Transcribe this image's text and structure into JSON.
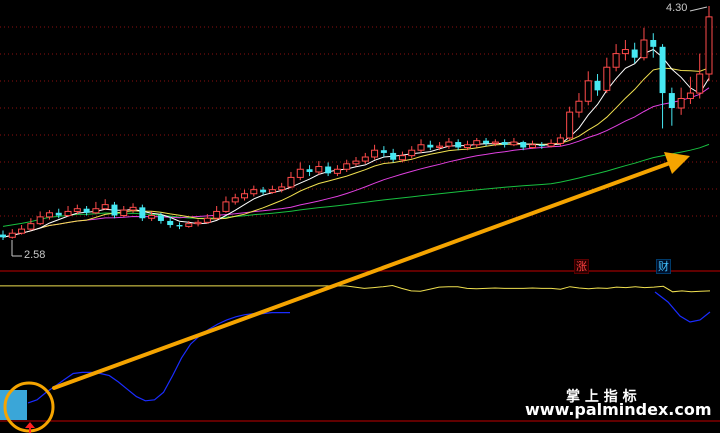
{
  "price_panel": {
    "high_label": "4.30",
    "low_label": "2.58",
    "event_badges": [
      "涨",
      "财"
    ],
    "candles": [
      [
        2.62,
        2.6,
        2.65,
        2.58
      ],
      [
        2.6,
        2.63,
        2.66,
        2.59
      ],
      [
        2.63,
        2.66,
        2.69,
        2.62
      ],
      [
        2.66,
        2.7,
        2.74,
        2.65
      ],
      [
        2.7,
        2.75,
        2.79,
        2.69
      ],
      [
        2.75,
        2.78,
        2.8,
        2.73
      ],
      [
        2.78,
        2.76,
        2.81,
        2.74
      ],
      [
        2.76,
        2.79,
        2.83,
        2.75
      ],
      [
        2.79,
        2.81,
        2.84,
        2.77
      ],
      [
        2.81,
        2.78,
        2.83,
        2.76
      ],
      [
        2.78,
        2.81,
        2.86,
        2.77
      ],
      [
        2.81,
        2.84,
        2.88,
        2.8
      ],
      [
        2.84,
        2.76,
        2.86,
        2.74
      ],
      [
        2.76,
        2.8,
        2.83,
        2.75
      ],
      [
        2.8,
        2.82,
        2.85,
        2.78
      ],
      [
        2.82,
        2.74,
        2.84,
        2.72
      ],
      [
        2.74,
        2.76,
        2.79,
        2.72
      ],
      [
        2.76,
        2.72,
        2.78,
        2.7
      ],
      [
        2.72,
        2.69,
        2.75,
        2.67
      ],
      [
        2.69,
        2.68,
        2.71,
        2.66
      ],
      [
        2.68,
        2.7,
        2.72,
        2.67
      ],
      [
        2.7,
        2.71,
        2.73,
        2.68
      ],
      [
        2.71,
        2.74,
        2.77,
        2.7
      ],
      [
        2.74,
        2.79,
        2.83,
        2.73
      ],
      [
        2.79,
        2.86,
        2.9,
        2.78
      ],
      [
        2.86,
        2.89,
        2.92,
        2.84
      ],
      [
        2.89,
        2.92,
        2.95,
        2.87
      ],
      [
        2.92,
        2.95,
        2.98,
        2.9
      ],
      [
        2.95,
        2.93,
        2.97,
        2.91
      ],
      [
        2.93,
        2.95,
        2.98,
        2.92
      ],
      [
        2.95,
        2.97,
        3.0,
        2.93
      ],
      [
        2.97,
        3.04,
        3.08,
        2.96
      ],
      [
        3.04,
        3.1,
        3.15,
        3.02
      ],
      [
        3.1,
        3.08,
        3.13,
        3.05
      ],
      [
        3.08,
        3.12,
        3.16,
        3.06
      ],
      [
        3.12,
        3.07,
        3.15,
        3.05
      ],
      [
        3.07,
        3.1,
        3.13,
        3.05
      ],
      [
        3.1,
        3.14,
        3.17,
        3.08
      ],
      [
        3.14,
        3.16,
        3.19,
        3.12
      ],
      [
        3.16,
        3.19,
        3.22,
        3.14
      ],
      [
        3.19,
        3.24,
        3.28,
        3.17
      ],
      [
        3.24,
        3.22,
        3.27,
        3.19
      ],
      [
        3.22,
        3.17,
        3.25,
        3.15
      ],
      [
        3.17,
        3.2,
        3.23,
        3.15
      ],
      [
        3.2,
        3.24,
        3.27,
        3.18
      ],
      [
        3.24,
        3.28,
        3.32,
        3.22
      ],
      [
        3.28,
        3.26,
        3.31,
        3.24
      ],
      [
        3.26,
        3.27,
        3.3,
        3.24
      ],
      [
        3.27,
        3.3,
        3.33,
        3.25
      ],
      [
        3.3,
        3.26,
        3.32,
        3.24
      ],
      [
        3.26,
        3.28,
        3.31,
        3.24
      ],
      [
        3.28,
        3.31,
        3.33,
        3.26
      ],
      [
        3.31,
        3.29,
        3.33,
        3.27
      ],
      [
        3.29,
        3.3,
        3.32,
        3.27
      ],
      [
        3.3,
        3.28,
        3.32,
        3.26
      ],
      [
        3.28,
        3.3,
        3.33,
        3.27
      ],
      [
        3.3,
        3.26,
        3.31,
        3.24
      ],
      [
        3.26,
        3.28,
        3.31,
        3.25
      ],
      [
        3.28,
        3.27,
        3.3,
        3.25
      ],
      [
        3.27,
        3.29,
        3.32,
        3.26
      ],
      [
        3.29,
        3.33,
        3.36,
        3.27
      ],
      [
        3.33,
        3.52,
        3.56,
        3.31
      ],
      [
        3.52,
        3.6,
        3.66,
        3.48
      ],
      [
        3.6,
        3.75,
        3.82,
        3.57
      ],
      [
        3.75,
        3.68,
        3.8,
        3.64
      ],
      [
        3.68,
        3.85,
        3.92,
        3.66
      ],
      [
        3.85,
        3.95,
        4.02,
        3.82
      ],
      [
        3.95,
        3.98,
        4.05,
        3.9
      ],
      [
        3.98,
        3.92,
        4.03,
        3.88
      ],
      [
        3.92,
        4.05,
        4.14,
        3.9
      ],
      [
        4.05,
        4.0,
        4.1,
        3.92
      ],
      [
        4.0,
        3.66,
        4.02,
        3.4
      ],
      [
        3.66,
        3.55,
        3.7,
        3.42
      ],
      [
        3.55,
        3.62,
        3.7,
        3.5
      ],
      [
        3.62,
        3.66,
        3.78,
        3.58
      ],
      [
        3.66,
        3.8,
        3.95,
        3.62
      ],
      [
        3.8,
        4.22,
        4.3,
        3.75
      ]
    ]
  },
  "indicator_panel": {
    "upper_line": [
      0.86,
      0.86,
      0.86,
      0.86,
      0.86,
      0.86,
      0.86,
      0.86,
      0.86,
      0.86,
      0.86,
      0.86,
      0.86,
      0.86,
      0.86,
      0.86,
      0.86,
      0.86,
      0.86,
      0.86,
      0.86,
      0.86,
      0.86,
      0.86,
      0.86,
      0.86,
      0.86,
      0.86,
      0.86,
      0.86,
      0.86,
      0.86,
      0.86,
      0.86,
      0.86,
      0.86,
      0.86,
      0.86,
      0.83,
      0.8,
      0.82,
      0.84,
      0.87,
      0.8,
      0.74,
      0.73,
      0.78,
      0.83,
      0.84,
      0.84,
      0.8,
      0.79,
      0.8,
      0.81,
      0.8,
      0.8,
      0.8,
      0.81,
      0.8,
      0.8,
      0.78,
      0.84,
      0.81,
      0.79,
      0.81,
      0.8,
      0.83,
      0.82,
      0.84,
      0.82,
      0.83,
      0.85,
      0.72,
      0.74,
      0.72,
      0.73,
      0.74
    ],
    "lower_line": [
      0.02,
      0.05,
      0.12,
      0.18,
      0.24,
      0.3,
      0.31,
      0.31,
      0.3,
      0.28,
      0.22,
      0.15,
      0.08,
      0.04,
      0.05,
      0.12,
      0.28,
      0.45,
      0.58,
      0.66,
      0.72,
      0.77,
      0.81,
      0.84,
      0.86,
      0.87,
      0.87,
      0.88,
      0.88,
      0.88
    ],
    "lower_color": "#1a2cff"
  },
  "overlay": {
    "arrow_color": "#f5a400",
    "circle_color": "#f5a400",
    "bottom_arrow_icon": "up-arrow-icon"
  },
  "watermark": {
    "cn": "掌 上 指 标",
    "url": "www.palmindex.com"
  },
  "colors": {
    "up": "#ff4b4b",
    "down": "#47e8f2",
    "ma_short": "#ffffff",
    "ma_mid": "#f0e050",
    "ma_long": "#e040e0",
    "ma_longer": "#18c040",
    "separator": "#c00000",
    "grid": "#8b1010"
  }
}
